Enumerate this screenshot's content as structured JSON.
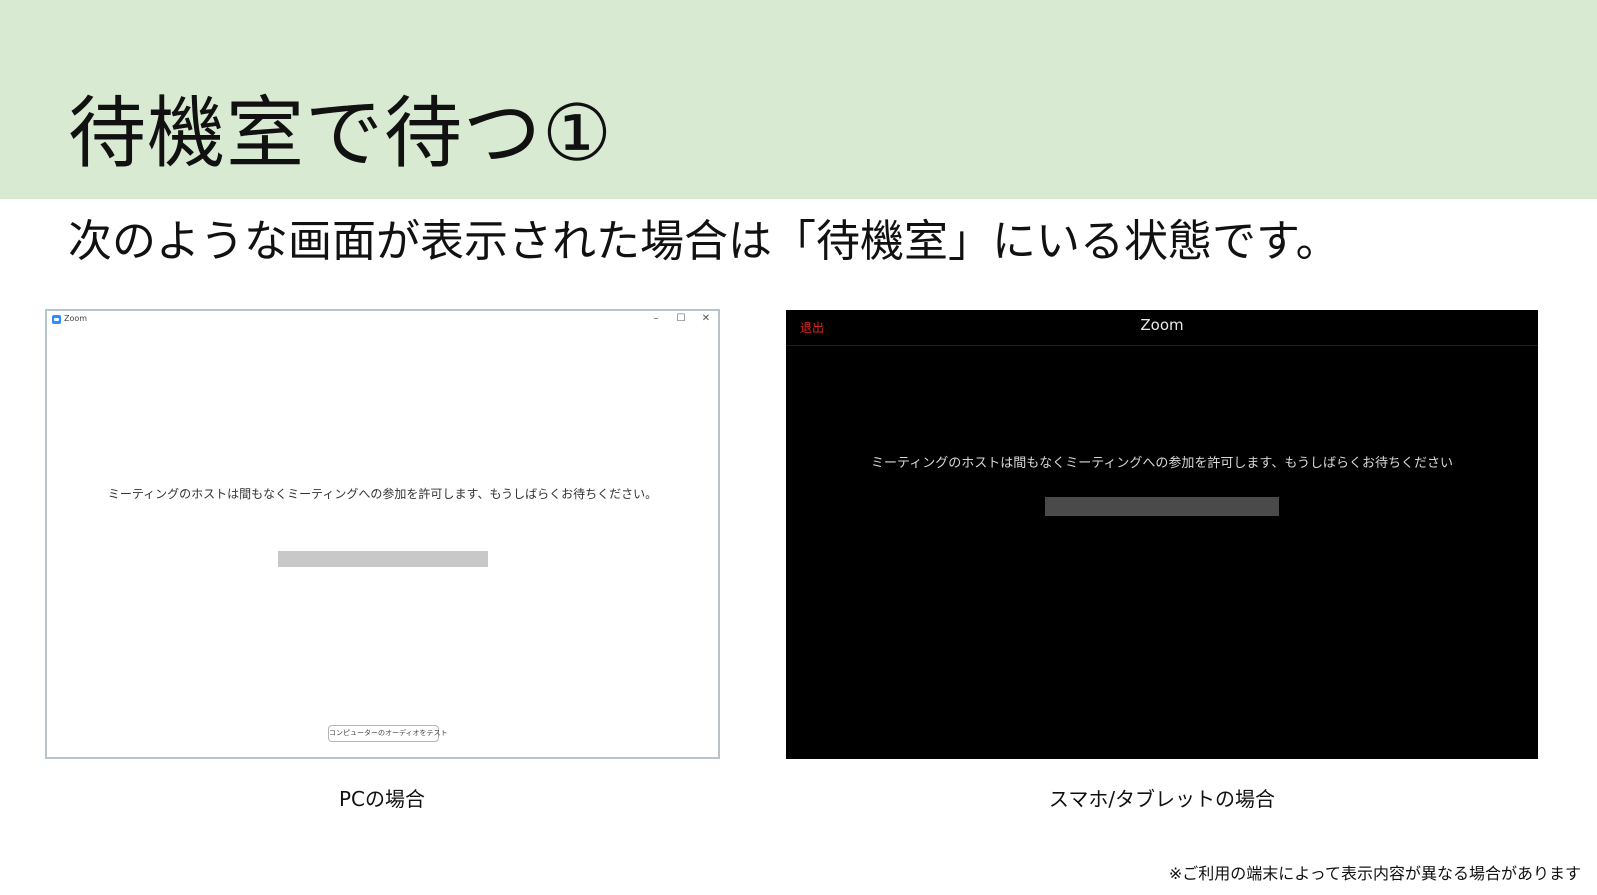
{
  "slide": {
    "title": "待機室で待つ①",
    "subtitle": "次のような画面が表示された場合は「待機室」にいる状態です。",
    "footnote": "※ご利用の端末によって表示内容が異なる場合があります",
    "header_color": "#d9ead3"
  },
  "pc_window": {
    "caption": "PCの場合",
    "app_title": "Zoom",
    "app_icon": "zoom-logo-icon",
    "controls": {
      "minimize": "–",
      "maximize": "☐",
      "close": "✕"
    },
    "message": "ミーティングのホストは間もなくミーティングへの参加を許可します、もうしばらくお待ちください。",
    "audio_test_label": "コンピューターのオーディオをテスト"
  },
  "mobile_screen": {
    "caption": "スマホ/タブレットの場合",
    "exit_label": "退出",
    "title": "Zoom",
    "message": "ミーティングのホストは間もなくミーティングへの参加を許可します、もうしばらくお待ちください",
    "exit_color": "#e02424"
  }
}
